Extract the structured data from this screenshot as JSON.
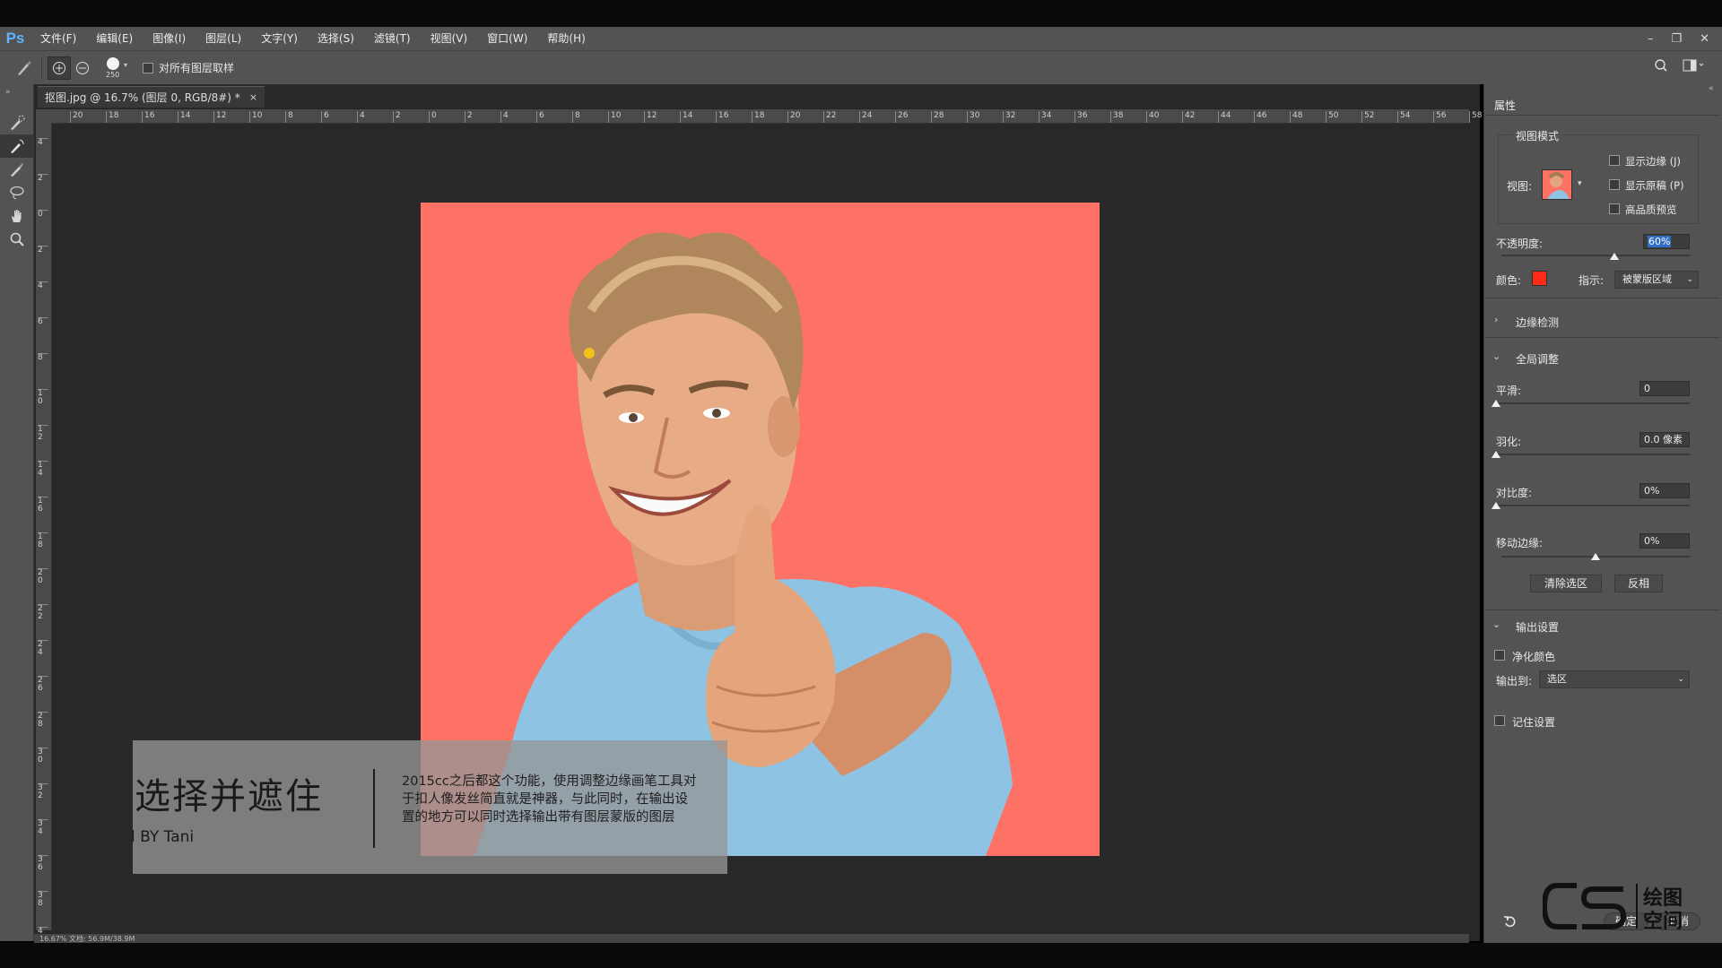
{
  "app": {
    "logo": "Ps"
  },
  "menu": [
    "文件(F)",
    "编辑(E)",
    "图像(I)",
    "图层(L)",
    "文字(Y)",
    "选择(S)",
    "滤镜(T)",
    "视图(V)",
    "窗口(W)",
    "帮助(H)"
  ],
  "options": {
    "brush_size": "250",
    "sample_all_layers_label": "对所有图层取样"
  },
  "document": {
    "tab_title": "抠图.jpg @ 16.7% (图层 0, RGB/8#) *"
  },
  "ruler": {
    "h_labels": [
      "20",
      "18",
      "16",
      "14",
      "12",
      "10",
      "8",
      "6",
      "4",
      "2",
      "0",
      "2",
      "4",
      "6",
      "8",
      "10",
      "12",
      "14",
      "16",
      "18",
      "20",
      "22",
      "24",
      "26",
      "28",
      "30",
      "32",
      "34",
      "36",
      "38",
      "40",
      "42",
      "44",
      "46",
      "48",
      "50",
      "52",
      "54",
      "56",
      "58"
    ],
    "v_labels": [
      "4",
      "2",
      "0",
      "2",
      "4",
      "6",
      "8",
      "1 0",
      "1 2",
      "1 4",
      "1 6",
      "1 8",
      "2 0",
      "2 2",
      "2 4",
      "2 6",
      "2 8",
      "3 0",
      "3 2",
      "3 4",
      "3 6",
      "3 8",
      "4 0"
    ]
  },
  "caption": {
    "title": "选择并遮住",
    "by": "l BY Tani",
    "body": "2015cc之后都这个功能，使用调整边缘画笔工具对于扣人像发丝简直就是神器，与此同时，在输出设置的地方可以同时选择输出带有图层蒙版的图层"
  },
  "status": {
    "text": "16.67%        文档: 56.9M/38.9M"
  },
  "panel": {
    "tab": "属性",
    "view_mode": {
      "heading": "视图模式",
      "view_label": "视图:",
      "show_edge": "显示边缘 (J)",
      "show_original": "显示原稿 (P)",
      "hq_preview": "高品质预览"
    },
    "opacity": {
      "label": "不透明度:",
      "value": "60%",
      "level": 0.6
    },
    "color": {
      "label": "颜色:",
      "swatch": "#ff2a17"
    },
    "indicate": {
      "label": "指示:",
      "value": "被蒙版区域"
    },
    "edge_detection": "边缘检测",
    "global_refinements": {
      "heading": "全局调整",
      "smooth": {
        "label": "平滑:",
        "value": "0",
        "level": 0.0
      },
      "feather": {
        "label": "羽化:",
        "value": "0.0 像素",
        "level": 0.0
      },
      "contrast": {
        "label": "对比度:",
        "value": "0%",
        "level": 0.0
      },
      "shift_edge": {
        "label": "移动边缘:",
        "value": "0%",
        "level": 0.5
      },
      "clear_selection": "清除选区",
      "invert": "反相"
    },
    "output": {
      "heading": "输出设置",
      "decontaminate": "净化颜色",
      "output_to_label": "输出到:",
      "output_to_value": "选区"
    },
    "remember": "记住设置",
    "ok": "确定",
    "cancel": "取消"
  },
  "watermark": {
    "text_top": "绘图",
    "text_bottom": "空间",
    "logo": "CS"
  },
  "colors": {
    "accent": "#5fb3ff",
    "photo_bg": "#fe7265",
    "panel": "#535353"
  }
}
